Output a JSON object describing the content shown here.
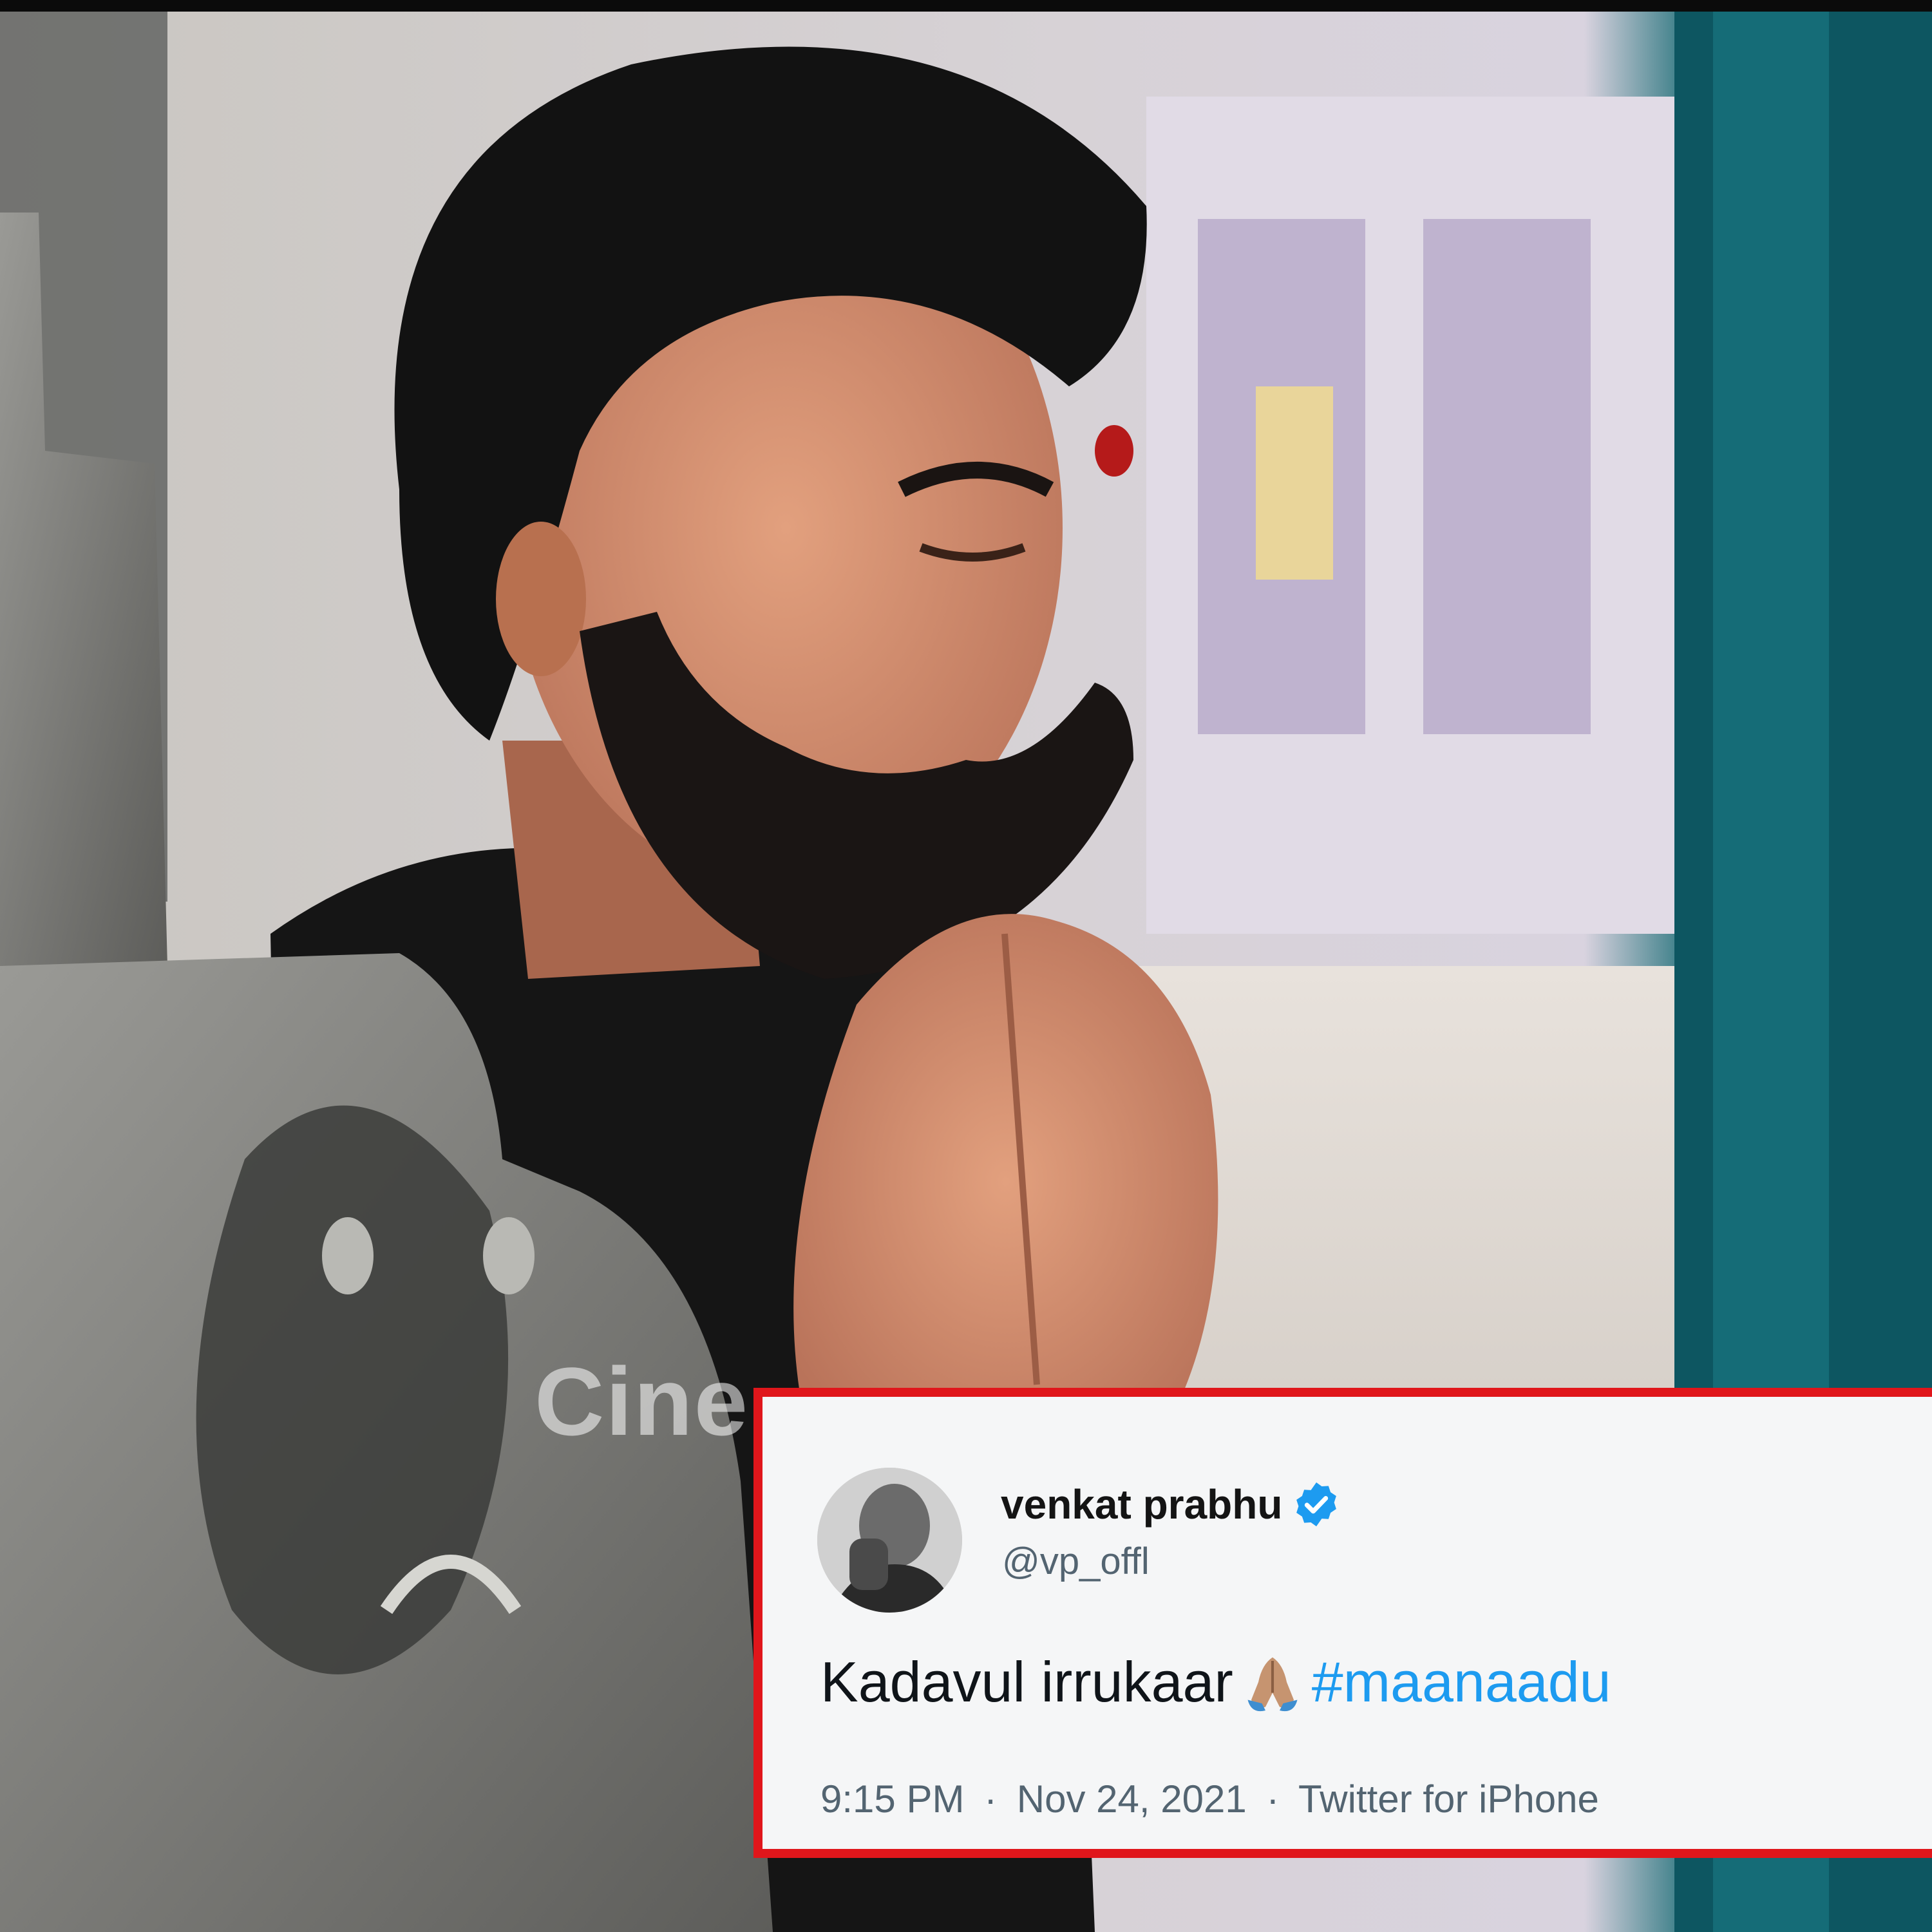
{
  "photo": {
    "subject": "man with beard praying with folded hands beside a stone lamp at a temple",
    "watermark": "Cine"
  },
  "tweet": {
    "display_name": "venkat prabhu",
    "handle": "@vp_offl",
    "verified_icon": "verified-badge-icon",
    "text": "Kadavul irrukaar",
    "emoji_icon": "folded-hands-icon",
    "hashtag": "#maanaadu",
    "time": "9:15 PM",
    "date": "Nov 24, 2021",
    "source": "Twitter for iPhone",
    "separator": "·"
  },
  "colors": {
    "card_border": "#e0161b",
    "hashtag": "#1d9bf0",
    "verified": "#1d9bf0"
  }
}
